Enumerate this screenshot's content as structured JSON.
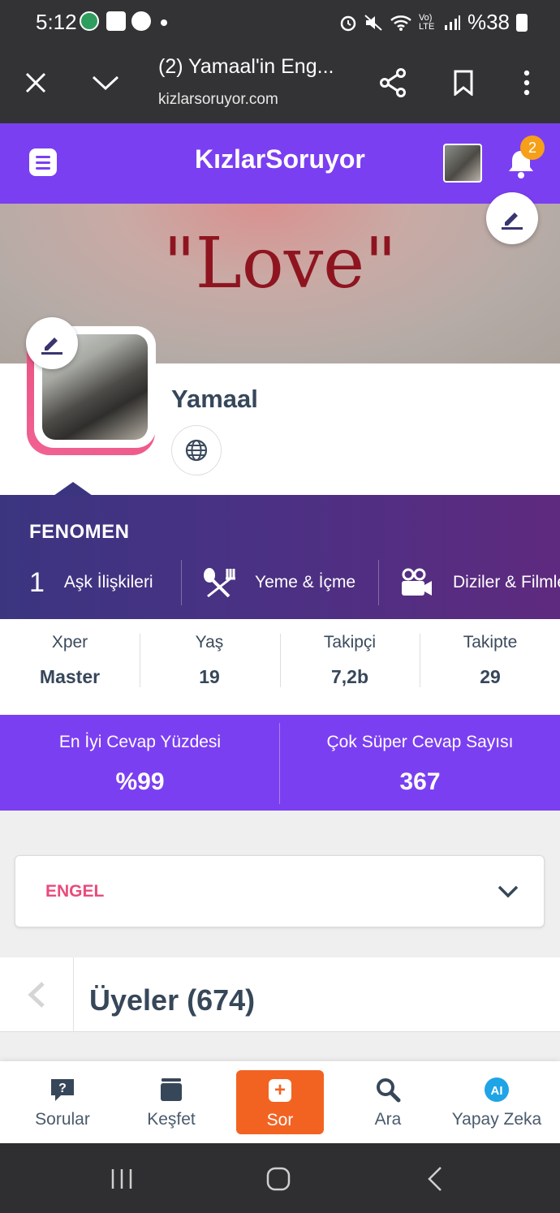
{
  "status_bar": {
    "time": "5:12",
    "battery": "%38",
    "network": "Vo) LTE"
  },
  "browser": {
    "title": "(2) Yamaal'in Eng...",
    "url": "kizlarsoruyor.com"
  },
  "site": {
    "logo": "KızlarSoruyor",
    "notification_count": "2",
    "brand_color": "#7b3ff2"
  },
  "cover": {
    "text": "\"Love\""
  },
  "profile": {
    "username": "Yamaal"
  },
  "fenomen": {
    "title": "FENOMEN",
    "items": [
      {
        "number": "1",
        "label": "Aşk İlişkileri",
        "icon": "rank-number"
      },
      {
        "label": "Yeme & İçme",
        "icon": "utensils-icon"
      },
      {
        "label": "Diziler & Filmler",
        "icon": "film-camera-icon"
      }
    ]
  },
  "stats": [
    {
      "label": "Xper",
      "value": "Master"
    },
    {
      "label": "Yaş",
      "value": "19"
    },
    {
      "label": "Takipçi",
      "value": "7,2b"
    },
    {
      "label": "Takipte",
      "value": "29"
    }
  ],
  "highlight_stats": [
    {
      "label": "En İyi Cevap Yüzdesi",
      "value": "%99"
    },
    {
      "label": "Çok Süper Cevap Sayısı",
      "value": "367"
    }
  ],
  "engel": {
    "label": "ENGEL"
  },
  "members": {
    "title": "Üyeler (674)"
  },
  "bottom_nav": [
    {
      "label": "Sorular",
      "icon": "question-bubble-icon"
    },
    {
      "label": "Keşfet",
      "icon": "stack-icon"
    },
    {
      "label": "Sor",
      "icon": "plus-icon"
    },
    {
      "label": "Ara",
      "icon": "search-icon"
    },
    {
      "label": "Yapay Zeka",
      "icon": "ai-icon"
    }
  ]
}
